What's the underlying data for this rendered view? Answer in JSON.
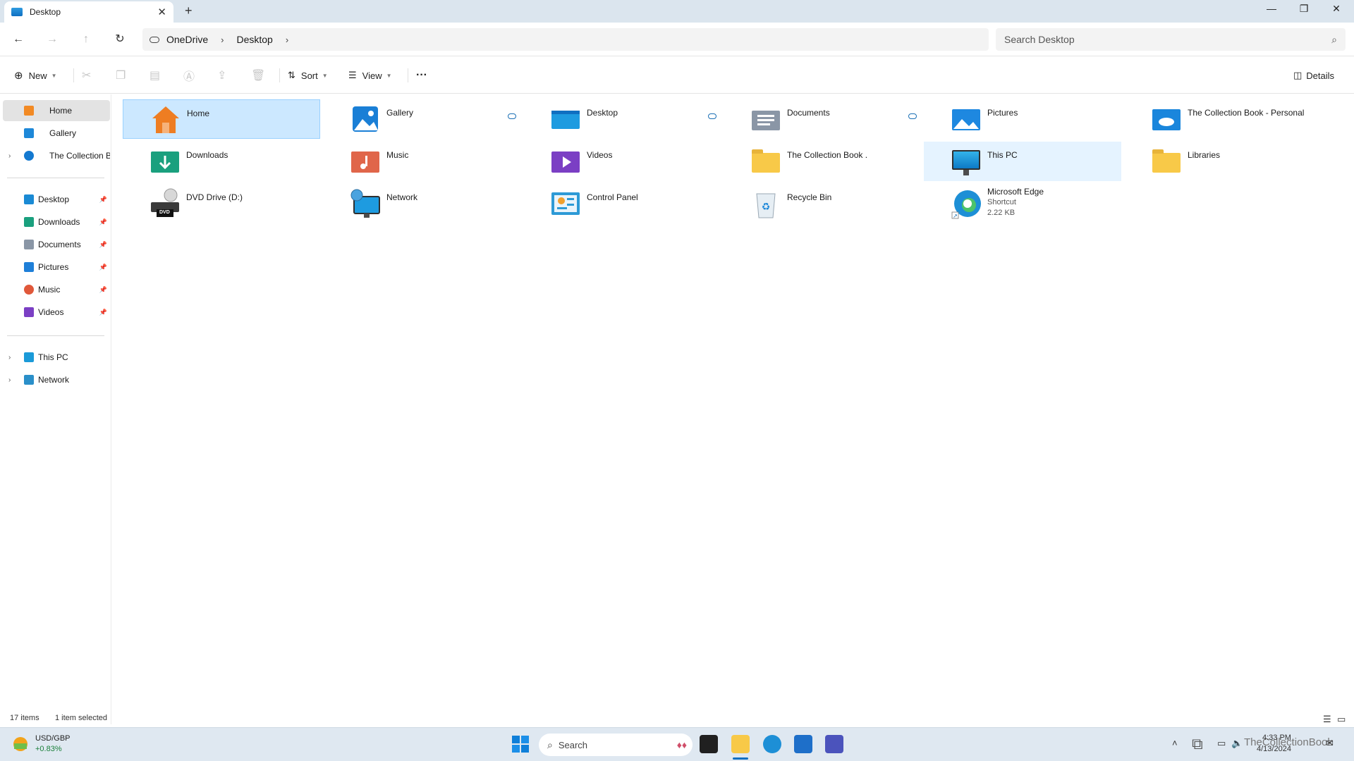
{
  "window": {
    "tab_title": "Desktop",
    "new_tab": "+",
    "minimize": "—",
    "maximize": "❐",
    "close": "✕"
  },
  "address": {
    "crumbs": [
      "OneDrive",
      "Desktop"
    ],
    "separator": "›",
    "search_placeholder": "Search Desktop"
  },
  "toolbar": {
    "new_label": "New",
    "sort_label": "Sort",
    "view_label": "View",
    "more_label": "···",
    "details_label": "Details"
  },
  "sidebar": {
    "top_items": [
      {
        "label": "Home"
      },
      {
        "label": "Gallery"
      },
      {
        "label": "The Collection Book - Personal"
      }
    ],
    "pinned_items": [
      {
        "label": "Desktop"
      },
      {
        "label": "Downloads"
      },
      {
        "label": "Documents"
      },
      {
        "label": "Pictures"
      },
      {
        "label": "Music"
      },
      {
        "label": "Videos"
      }
    ],
    "bottom_items": [
      {
        "label": "This PC"
      },
      {
        "label": "Network"
      }
    ]
  },
  "content": {
    "items": [
      {
        "label": "Home"
      },
      {
        "label": "Gallery"
      },
      {
        "label": "Desktop"
      },
      {
        "label": "Documents"
      },
      {
        "label": "Pictures"
      },
      {
        "label": "The Collection Book - Personal"
      },
      {
        "label": "Downloads"
      },
      {
        "label": "Music"
      },
      {
        "label": "Videos"
      },
      {
        "label": "The Collection Book ."
      },
      {
        "label": "This PC"
      },
      {
        "label": "Libraries"
      },
      {
        "label": "DVD Drive (D:)"
      },
      {
        "label": "Network"
      },
      {
        "label": "Control Panel"
      },
      {
        "label": "Recycle Bin"
      },
      {
        "label": "Microsoft Edge",
        "sub1": "Shortcut",
        "sub2": "2.22 KB"
      }
    ],
    "dvd_badge": "DVD"
  },
  "status": {
    "count": "17 items",
    "selection": "1 item selected"
  },
  "taskbar": {
    "widget_title": "USD/GBP",
    "widget_value": "+0.83%",
    "search_label": "Search",
    "time": "4:33 PM",
    "date": "4/13/2024",
    "watermark": "TheCollectionBook"
  },
  "colors": {
    "selection": "#cce8ff",
    "hover": "#e5f3ff",
    "folder": "#f8c948",
    "accent": "#0f6fc1"
  }
}
